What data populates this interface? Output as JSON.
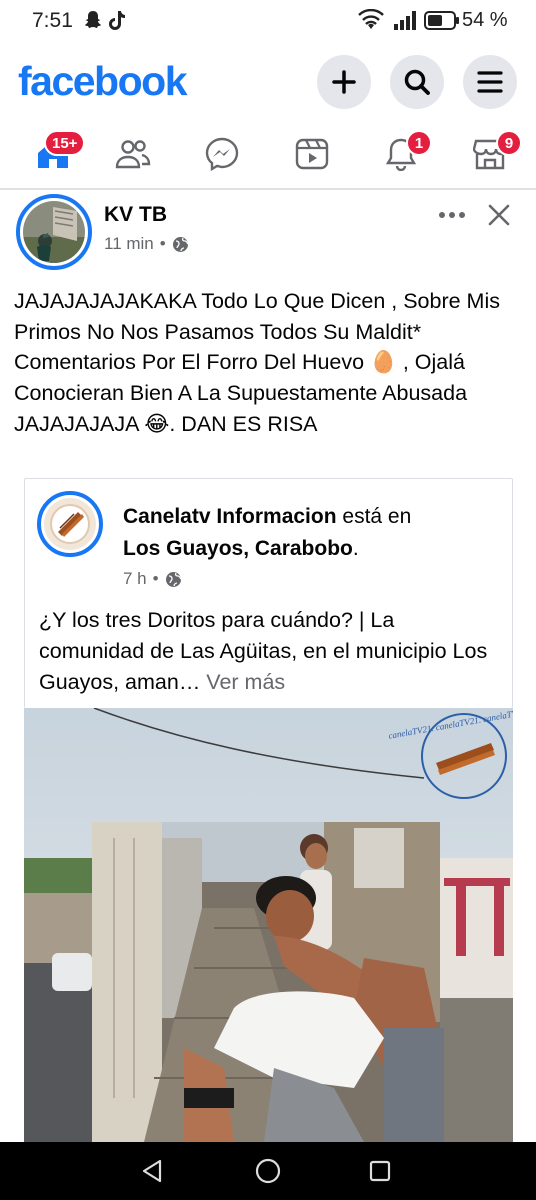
{
  "status_bar": {
    "time": "7:51",
    "battery": "54 %",
    "icons": [
      "snapchat-icon",
      "tiktok-icon",
      "wifi-icon",
      "signal-icon",
      "battery-icon"
    ]
  },
  "header": {
    "brand": "facebook",
    "buttons": [
      "add-icon",
      "search-icon",
      "menu-icon"
    ]
  },
  "nav": {
    "items": [
      {
        "name": "home",
        "badge": "15+"
      },
      {
        "name": "friends",
        "badge": ""
      },
      {
        "name": "messenger",
        "badge": ""
      },
      {
        "name": "video",
        "badge": ""
      },
      {
        "name": "notifications",
        "badge": "1"
      },
      {
        "name": "marketplace",
        "badge": "9"
      }
    ]
  },
  "post": {
    "author": "KV TB",
    "time": "11 min",
    "separator": "•",
    "text": "JAJAJAJAJAKAKA Todo Lo Que Dicen , Sobre Mis Primos No Nos Pasamos Todos Su Maldit* Comentarios Por El Forro Del Huevo 🥚 , Ojalá Conocieran Bien A La Supuestamente Abusada JAJAJAJAJA 😂. DAN ES RISA"
  },
  "shared": {
    "page_name": "Canelatv Informacion",
    "connector": " está en",
    "location": "Los Guayos, Carabobo",
    "location_end": ".",
    "time": "7 h",
    "separator": "•",
    "text": "¿Y los tres Doritos para cuándo? | La comunidad de Las Agüitas, en el municipio Los Guayos, aman…",
    "see_more": " Ver más",
    "watermark": "canelaTV21. canelaTV21. canelaTV21."
  },
  "colors": {
    "brand": "#1877f2",
    "badge": "#e41e3f",
    "secondary_text": "#65676b"
  }
}
